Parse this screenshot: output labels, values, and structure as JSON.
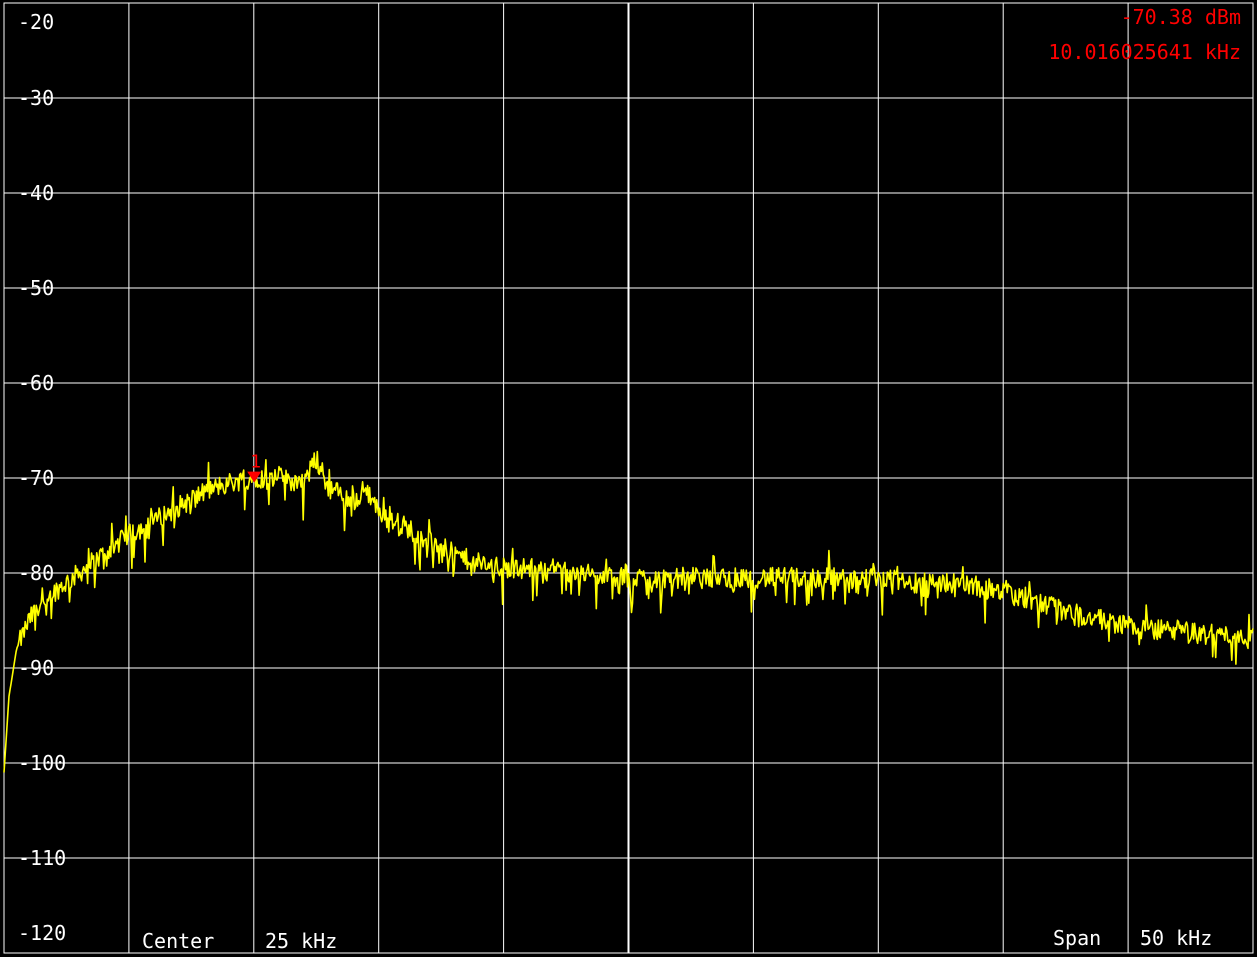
{
  "colors": {
    "background": "#000000",
    "grid": "#ffffff",
    "trace": "#ffff00",
    "marker": "#ff0000",
    "label": "#ffffff"
  },
  "marker": {
    "label": "1",
    "readout_level": "-70.38 dBm",
    "readout_freq": "10.016025641 kHz",
    "x_khz": 10.016,
    "y_dbm": -70.38
  },
  "footer": {
    "center_label": "Center",
    "center_value": "25 kHz",
    "span_label": "Span",
    "span_value": "50 kHz"
  },
  "chart_data": {
    "type": "line",
    "title": "",
    "xlabel": "",
    "ylabel": "",
    "xlim": [
      0,
      50
    ],
    "ylim": [
      -120,
      -20
    ],
    "grid": true,
    "y_ticks": [
      -20,
      -30,
      -40,
      -50,
      -60,
      -70,
      -80,
      -90,
      -100,
      -110,
      -120
    ],
    "y_tick_labels": [
      "-20",
      "-30",
      "-40",
      "-50",
      "-60",
      "-70",
      "-80",
      "-90",
      "-100",
      "-110",
      "-120"
    ],
    "x_divisions": 10,
    "series": [
      {
        "x": [
          0,
          0.2,
          0.5,
          1,
          1.5,
          2,
          3,
          4,
          5,
          6,
          7,
          8,
          9,
          10,
          11,
          12,
          12.5,
          13,
          14,
          14.5,
          15,
          16,
          17,
          18,
          19,
          20,
          21,
          22,
          23,
          24,
          25,
          26,
          27,
          28,
          29,
          30,
          31,
          32,
          33,
          34,
          35,
          36,
          37,
          38,
          39,
          40,
          41,
          42,
          43,
          44,
          45,
          46,
          47,
          48,
          49,
          50
        ],
        "y": [
          -101,
          -93,
          -88,
          -85,
          -83,
          -82,
          -80,
          -78,
          -76,
          -74.5,
          -73,
          -71.5,
          -70.5,
          -70,
          -70,
          -70.5,
          -68,
          -71,
          -72.5,
          -71,
          -73.5,
          -75,
          -76.5,
          -78,
          -79,
          -79.5,
          -79.5,
          -79.5,
          -80,
          -80.5,
          -80.5,
          -80.5,
          -80.5,
          -80.5,
          -80.5,
          -80.5,
          -80.5,
          -80.5,
          -80.5,
          -80.5,
          -80.5,
          -81,
          -81,
          -81,
          -81.5,
          -82,
          -83,
          -83.5,
          -84.5,
          -85,
          -85.5,
          -86,
          -86,
          -86.5,
          -86.5,
          -86.5
        ]
      }
    ]
  }
}
